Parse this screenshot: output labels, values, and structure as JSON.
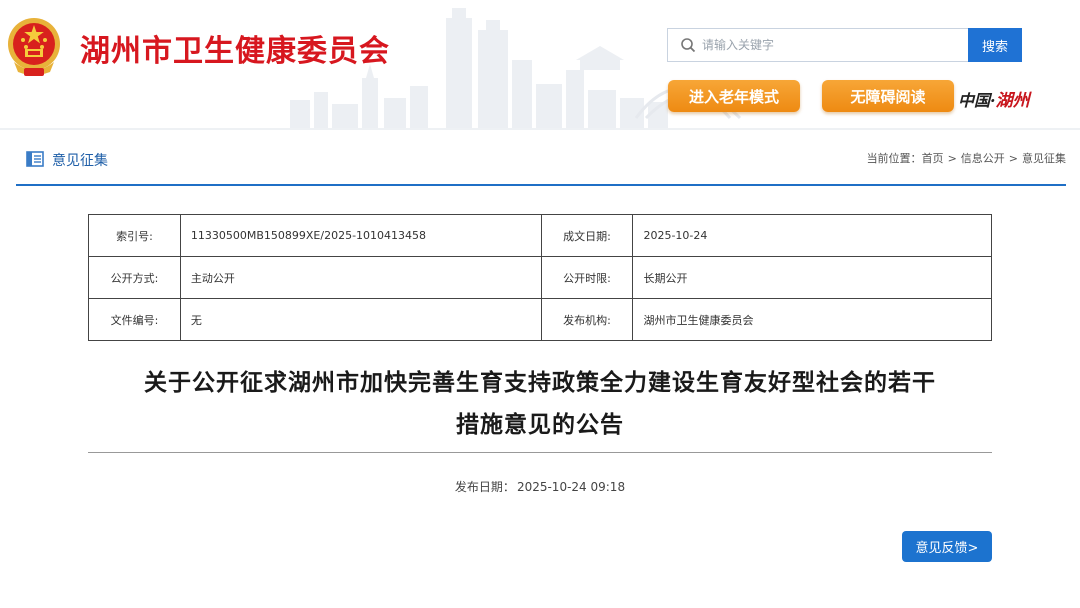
{
  "header": {
    "site_title": "湖州市卫生健康委员会",
    "search": {
      "placeholder": "请输入关键字",
      "button_label": "搜索"
    },
    "elder_mode_label": "进入老年模式",
    "accessible_label": "无障碍阅读",
    "brand_part1": "中国·",
    "brand_part2": "湖州"
  },
  "section": {
    "title": "意见征集",
    "breadcrumb": {
      "prefix": "当前位置：",
      "items": [
        "首页",
        "信息公开",
        "意见征集"
      ],
      "separator": ">"
    }
  },
  "meta": {
    "rows": [
      {
        "k1": "索引号:",
        "v1": "11330500MB150899XE/2025-1010413458",
        "k2": "成文日期:",
        "v2": "2025-10-24"
      },
      {
        "k1": "公开方式:",
        "v1": "主动公开",
        "k2": "公开时限:",
        "v2": "长期公开"
      },
      {
        "k1": "文件编号:",
        "v1": "无",
        "k2": "发布机构:",
        "v2": "湖州市卫生健康委员会"
      }
    ]
  },
  "article": {
    "title_line1": "关于公开征求湖州市加快完善生育支持政策全力建设生育友好型社会的若干",
    "title_line2": "措施意见的公告",
    "publish_label": "发布日期：",
    "publish_date": "2025-10-24 09:18"
  },
  "feedback_label": "意见反馈>",
  "colors": {
    "title_red": "#d7171f",
    "accent_blue": "#1f72d4",
    "button_orange": "#ee8a12"
  },
  "icons": [
    "emblem-icon",
    "search-icon",
    "document-icon"
  ]
}
